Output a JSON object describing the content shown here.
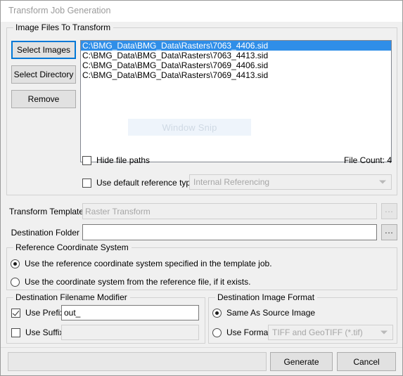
{
  "window": {
    "title": "Transform Job Generation"
  },
  "image_files_group": {
    "label": "Image Files To Transform",
    "buttons": {
      "select_images": "Select Images",
      "select_directory": "Select Directory",
      "remove": "Remove"
    },
    "files": [
      "C:\\BMG_Data\\BMG_Data\\Rasters\\7063_4406.sid",
      "C:\\BMG_Data\\BMG_Data\\Rasters\\7063_4413.sid",
      "C:\\BMG_Data\\BMG_Data\\Rasters\\7069_4406.sid",
      "C:\\BMG_Data\\BMG_Data\\Rasters\\7069_4413.sid"
    ],
    "selected_index": 0,
    "snip_overlay": "Window Snip",
    "hide_file_paths": {
      "label": "Hide file paths",
      "checked": false
    },
    "file_count": "File Count: 4",
    "use_default_reference_type": {
      "label": "Use default reference type",
      "checked": false
    },
    "reference_type_value": "Internal Referencing"
  },
  "transform_template": {
    "label": "Transform Template",
    "value": "Raster Transform",
    "browse_label": "..."
  },
  "destination_folder": {
    "label": "Destination Folder",
    "value": "",
    "browse_label": "..."
  },
  "reference_coordinate_system": {
    "label": "Reference Coordinate System",
    "options": [
      "Use the reference coordinate system specified in the template job.",
      "Use the coordinate system from the reference file, if it exists."
    ],
    "selected_index": 0
  },
  "destination_filename_modifier": {
    "label": "Destination Filename Modifier",
    "use_prefix": {
      "label": "Use Prefix",
      "checked": true,
      "value": "out_"
    },
    "use_suffix": {
      "label": "Use Suffix",
      "checked": false,
      "value": ""
    }
  },
  "destination_image_format": {
    "label": "Destination Image Format",
    "same_as_source": {
      "label": "Same As Source Image",
      "selected": true
    },
    "use_format": {
      "label": "Use Format",
      "selected": false,
      "value": "TIFF and GeoTIFF (*.tif)"
    }
  },
  "footer": {
    "generate_label": "Generate",
    "cancel_label": "Cancel",
    "status_text": ""
  },
  "colors": {
    "selection_blue": "#2f8ee8",
    "focus_blue": "#0078d7",
    "dialog_face": "#f0f0f0"
  }
}
